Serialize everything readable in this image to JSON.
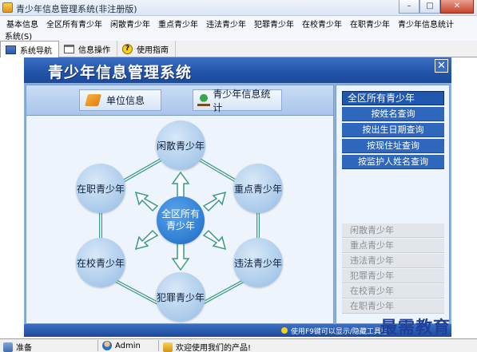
{
  "window": {
    "title": "青少年信息管理系统(非注册版)",
    "min_label": "–",
    "max_label": "□",
    "close_label": "✕"
  },
  "menu": {
    "items": [
      "基本信息",
      "全区所有青少年",
      "闲散青少年",
      "重点青少年",
      "违法青少年",
      "犯罪青少年",
      "在校青少年",
      "在职青少年",
      "青少年信息统计"
    ],
    "second_row": "系统(S)"
  },
  "tabs": [
    {
      "label": "系统导航",
      "icon": "nav-icon",
      "active": true
    },
    {
      "label": "信息操作",
      "icon": "document-icon",
      "active": false
    },
    {
      "label": "使用指南",
      "icon": "help-icon",
      "active": false
    }
  ],
  "header": {
    "title": "青少年信息管理系统",
    "close_label": "✕"
  },
  "top_buttons": {
    "unit_info": "单位信息",
    "stats": "青少年信息统计"
  },
  "diagram": {
    "center": "全区所有青少年",
    "nodes": {
      "idle": "闲散青少年",
      "key": "重点青少年",
      "illegal": "违法青少年",
      "criminal": "犯罪青少年",
      "school": "在校青少年",
      "employed": "在职青少年"
    }
  },
  "right_panel": {
    "title": "全区所有青少年",
    "queries": [
      "按姓名查询",
      "按出生日期查询",
      "按现住址查询",
      "按监护人姓名查询"
    ],
    "categories": [
      "闲散青少年",
      "重点青少年",
      "违法青少年",
      "犯罪青少年",
      "在校青少年",
      "在职青少年"
    ]
  },
  "bottom": {
    "notice": "使用F9键可以显示/隐藏工具栏"
  },
  "watermark": "最需教育",
  "status": {
    "ready": "准备",
    "user": "Admin",
    "message": "欢迎使用我们的产品!"
  },
  "colors": {
    "header_blue": "#2153a8",
    "panel_blue": "#8db0dc",
    "node_blue": "#a9c9ea",
    "connector_green": "#3a9a8a"
  }
}
